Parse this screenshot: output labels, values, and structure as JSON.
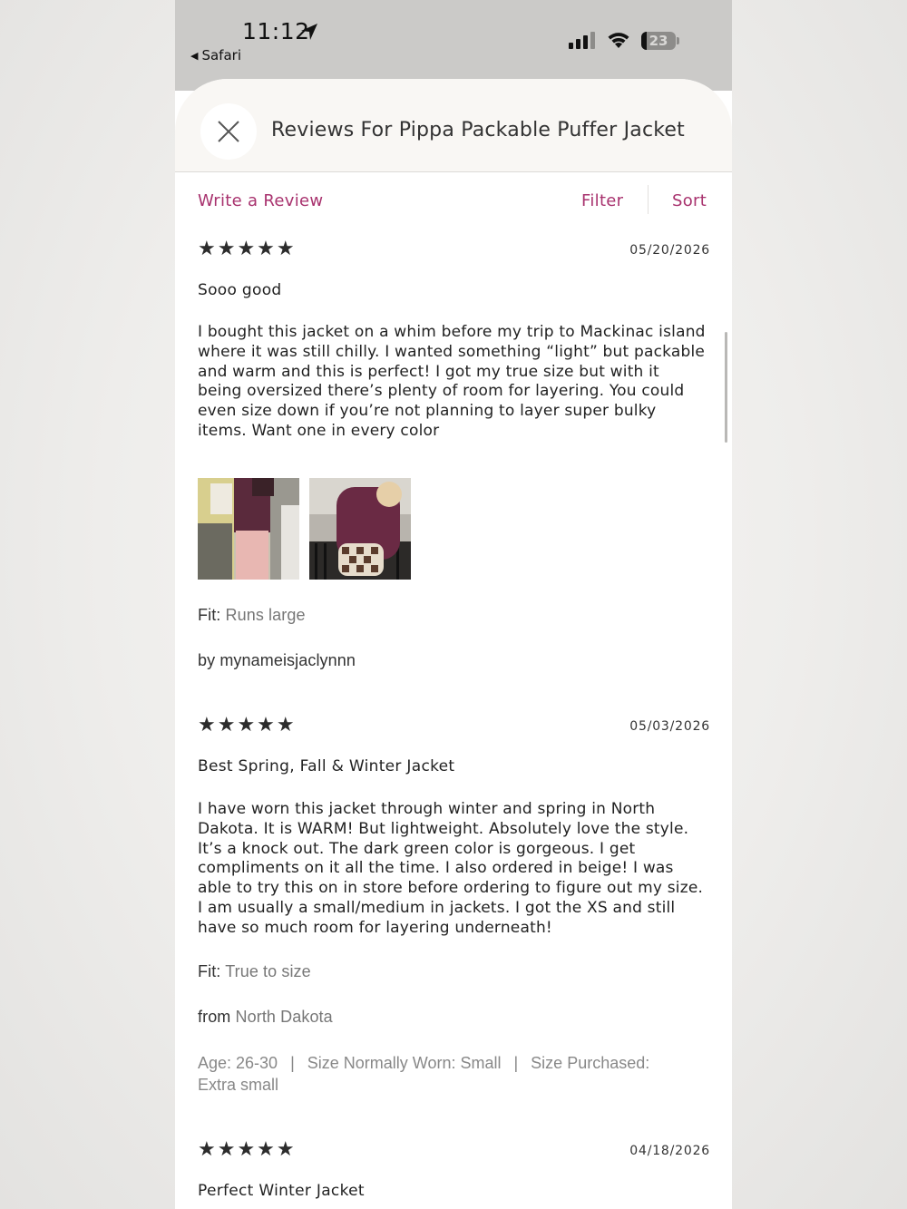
{
  "status_bar": {
    "time": "11:12",
    "back_label": "Safari",
    "battery": "23"
  },
  "sheet": {
    "title": "Reviews For Pippa Packable Puffer Jacket",
    "close_icon": "close-icon"
  },
  "actions": {
    "write_review": "Write a Review",
    "filter": "Filter",
    "sort": "Sort"
  },
  "reviews": [
    {
      "stars": "★★★★★",
      "rating": 5,
      "date": "05/20/2026",
      "title": "Sooo good",
      "body": "I bought this jacket on a whim before my trip to Mackinac island where it was still chilly. I wanted something “light” but packable and warm and this is perfect! I got my true size but with it being oversized there’s plenty of room for layering. You could even size down if you’re not planning to layer super bulky items. Want one in every color",
      "fit_label": "Fit:",
      "fit_value": "Runs large",
      "by_label": "by",
      "author": "mynameisjaclynnn"
    },
    {
      "stars": "★★★★★",
      "rating": 5,
      "date": "05/03/2026",
      "title": "Best Spring, Fall & Winter Jacket",
      "body": "I have worn this jacket through winter and spring in North Dakota. It is WARM! But lightweight. Absolutely love the style. It’s a knock out. The dark green color is gorgeous. I get compliments on it all the time. I also ordered in beige! I was able to try this on in store before ordering to figure out my size. I am usually a small/medium in jackets. I got the XS and still have so much room for layering underneath!",
      "fit_label": "Fit:",
      "fit_value": "True to size",
      "from_label": "from",
      "location": "North Dakota",
      "age": "Age: 26-30",
      "size_worn": "Size Normally Worn: Small",
      "size_purchased": "Size Purchased: Extra small",
      "separator": "|"
    },
    {
      "stars": "★★★★★",
      "rating": 5,
      "date": "04/18/2026",
      "title": "Perfect Winter Jacket"
    }
  ],
  "colors": {
    "accent": "#a8326e",
    "status_bar": "#cbcac8",
    "header_bg": "#f9f7f4"
  }
}
